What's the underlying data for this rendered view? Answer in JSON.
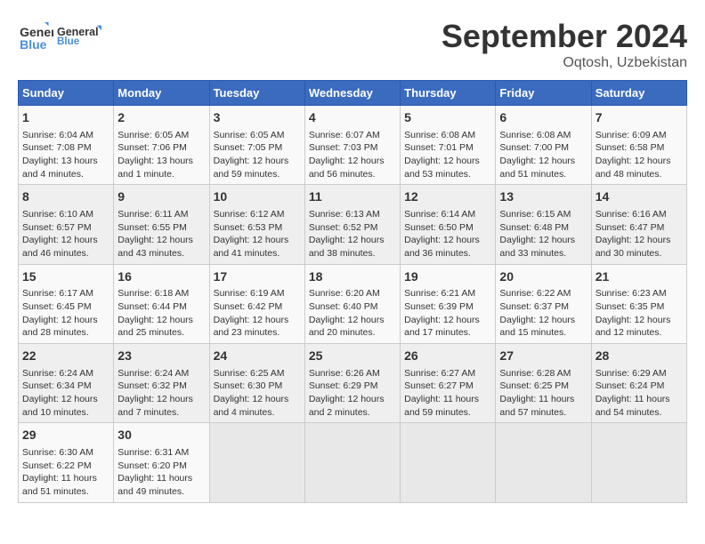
{
  "header": {
    "logo_line1": "General",
    "logo_line2": "Blue",
    "month": "September 2024",
    "location": "Oqtosh, Uzbekistan"
  },
  "weekdays": [
    "Sunday",
    "Monday",
    "Tuesday",
    "Wednesday",
    "Thursday",
    "Friday",
    "Saturday"
  ],
  "weeks": [
    [
      {
        "day": "1",
        "info": "Sunrise: 6:04 AM\nSunset: 7:08 PM\nDaylight: 13 hours and 4 minutes."
      },
      {
        "day": "2",
        "info": "Sunrise: 6:05 AM\nSunset: 7:06 PM\nDaylight: 13 hours and 1 minute."
      },
      {
        "day": "3",
        "info": "Sunrise: 6:05 AM\nSunset: 7:05 PM\nDaylight: 12 hours and 59 minutes."
      },
      {
        "day": "4",
        "info": "Sunrise: 6:07 AM\nSunset: 7:03 PM\nDaylight: 12 hours and 56 minutes."
      },
      {
        "day": "5",
        "info": "Sunrise: 6:08 AM\nSunset: 7:01 PM\nDaylight: 12 hours and 53 minutes."
      },
      {
        "day": "6",
        "info": "Sunrise: 6:08 AM\nSunset: 7:00 PM\nDaylight: 12 hours and 51 minutes."
      },
      {
        "day": "7",
        "info": "Sunrise: 6:09 AM\nSunset: 6:58 PM\nDaylight: 12 hours and 48 minutes."
      }
    ],
    [
      {
        "day": "8",
        "info": "Sunrise: 6:10 AM\nSunset: 6:57 PM\nDaylight: 12 hours and 46 minutes."
      },
      {
        "day": "9",
        "info": "Sunrise: 6:11 AM\nSunset: 6:55 PM\nDaylight: 12 hours and 43 minutes."
      },
      {
        "day": "10",
        "info": "Sunrise: 6:12 AM\nSunset: 6:53 PM\nDaylight: 12 hours and 41 minutes."
      },
      {
        "day": "11",
        "info": "Sunrise: 6:13 AM\nSunset: 6:52 PM\nDaylight: 12 hours and 38 minutes."
      },
      {
        "day": "12",
        "info": "Sunrise: 6:14 AM\nSunset: 6:50 PM\nDaylight: 12 hours and 36 minutes."
      },
      {
        "day": "13",
        "info": "Sunrise: 6:15 AM\nSunset: 6:48 PM\nDaylight: 12 hours and 33 minutes."
      },
      {
        "day": "14",
        "info": "Sunrise: 6:16 AM\nSunset: 6:47 PM\nDaylight: 12 hours and 30 minutes."
      }
    ],
    [
      {
        "day": "15",
        "info": "Sunrise: 6:17 AM\nSunset: 6:45 PM\nDaylight: 12 hours and 28 minutes."
      },
      {
        "day": "16",
        "info": "Sunrise: 6:18 AM\nSunset: 6:44 PM\nDaylight: 12 hours and 25 minutes."
      },
      {
        "day": "17",
        "info": "Sunrise: 6:19 AM\nSunset: 6:42 PM\nDaylight: 12 hours and 23 minutes."
      },
      {
        "day": "18",
        "info": "Sunrise: 6:20 AM\nSunset: 6:40 PM\nDaylight: 12 hours and 20 minutes."
      },
      {
        "day": "19",
        "info": "Sunrise: 6:21 AM\nSunset: 6:39 PM\nDaylight: 12 hours and 17 minutes."
      },
      {
        "day": "20",
        "info": "Sunrise: 6:22 AM\nSunset: 6:37 PM\nDaylight: 12 hours and 15 minutes."
      },
      {
        "day": "21",
        "info": "Sunrise: 6:23 AM\nSunset: 6:35 PM\nDaylight: 12 hours and 12 minutes."
      }
    ],
    [
      {
        "day": "22",
        "info": "Sunrise: 6:24 AM\nSunset: 6:34 PM\nDaylight: 12 hours and 10 minutes."
      },
      {
        "day": "23",
        "info": "Sunrise: 6:24 AM\nSunset: 6:32 PM\nDaylight: 12 hours and 7 minutes."
      },
      {
        "day": "24",
        "info": "Sunrise: 6:25 AM\nSunset: 6:30 PM\nDaylight: 12 hours and 4 minutes."
      },
      {
        "day": "25",
        "info": "Sunrise: 6:26 AM\nSunset: 6:29 PM\nDaylight: 12 hours and 2 minutes."
      },
      {
        "day": "26",
        "info": "Sunrise: 6:27 AM\nSunset: 6:27 PM\nDaylight: 11 hours and 59 minutes."
      },
      {
        "day": "27",
        "info": "Sunrise: 6:28 AM\nSunset: 6:25 PM\nDaylight: 11 hours and 57 minutes."
      },
      {
        "day": "28",
        "info": "Sunrise: 6:29 AM\nSunset: 6:24 PM\nDaylight: 11 hours and 54 minutes."
      }
    ],
    [
      {
        "day": "29",
        "info": "Sunrise: 6:30 AM\nSunset: 6:22 PM\nDaylight: 11 hours and 51 minutes."
      },
      {
        "day": "30",
        "info": "Sunrise: 6:31 AM\nSunset: 6:20 PM\nDaylight: 11 hours and 49 minutes."
      },
      {
        "day": "",
        "info": ""
      },
      {
        "day": "",
        "info": ""
      },
      {
        "day": "",
        "info": ""
      },
      {
        "day": "",
        "info": ""
      },
      {
        "day": "",
        "info": ""
      }
    ]
  ]
}
